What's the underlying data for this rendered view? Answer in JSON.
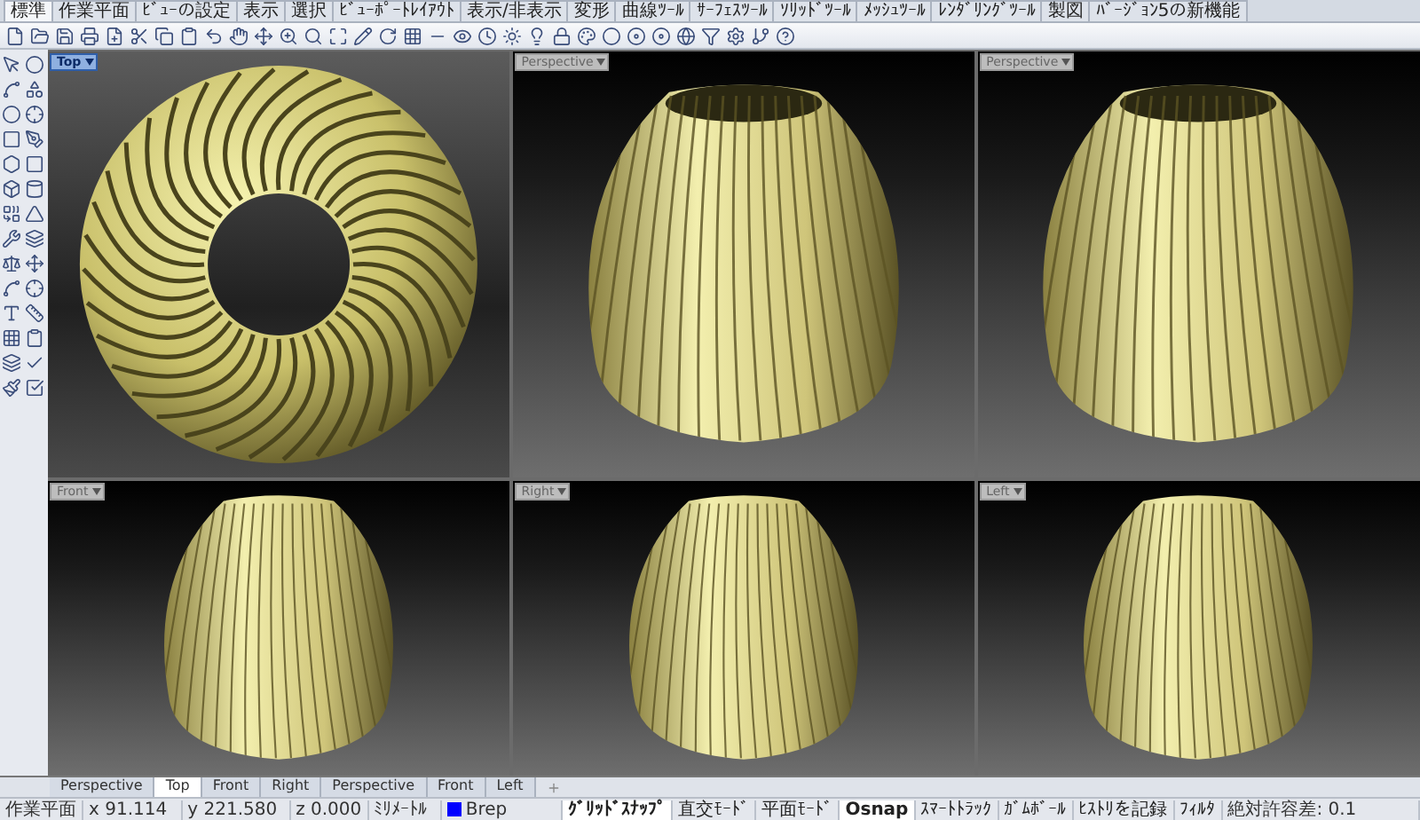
{
  "ribbon_tabs": [
    {
      "label": "標準",
      "selected": true
    },
    {
      "label": "作業平面",
      "selected": false
    },
    {
      "label": "ﾋﾞｭｰの設定",
      "selected": false
    },
    {
      "label": "表示",
      "selected": false
    },
    {
      "label": "選択",
      "selected": false
    },
    {
      "label": "ﾋﾞｭｰﾎﾟｰﾄﾚｲｱｳﾄ",
      "selected": false
    },
    {
      "label": "表示/非表示",
      "selected": false
    },
    {
      "label": "変形",
      "selected": false
    },
    {
      "label": "曲線ﾂｰﾙ",
      "selected": false
    },
    {
      "label": "ｻｰﾌｪｽﾂｰﾙ",
      "selected": false
    },
    {
      "label": "ｿﾘｯﾄﾞﾂｰﾙ",
      "selected": false
    },
    {
      "label": "ﾒｯｼｭﾂｰﾙ",
      "selected": false
    },
    {
      "label": "ﾚﾝﾀﾞﾘﾝｸﾞﾂｰﾙ",
      "selected": false
    },
    {
      "label": "製図",
      "selected": false
    },
    {
      "label": "ﾊﾞｰｼﾞｮﾝ5の新機能",
      "selected": false
    }
  ],
  "viewports": [
    {
      "label": "Top",
      "active": true,
      "kind": "torus"
    },
    {
      "label": "Perspective",
      "active": false,
      "kind": "vase-open"
    },
    {
      "label": "Perspective",
      "active": false,
      "kind": "vase-open"
    },
    {
      "label": "Front",
      "active": false,
      "kind": "vase"
    },
    {
      "label": "Right",
      "active": false,
      "kind": "vase"
    },
    {
      "label": "Left",
      "active": false,
      "kind": "vase"
    }
  ],
  "view_tabs": [
    {
      "label": "Perspective",
      "selected": false
    },
    {
      "label": "Top",
      "selected": true
    },
    {
      "label": "Front",
      "selected": false
    },
    {
      "label": "Right",
      "selected": false
    },
    {
      "label": "Perspective",
      "selected": false
    },
    {
      "label": "Front",
      "selected": false
    },
    {
      "label": "Left",
      "selected": false
    }
  ],
  "status_bar": {
    "cplane": "作業平面",
    "x": "x 91.114",
    "y": "y 221.580",
    "z": "z 0.000",
    "units": "ﾐﾘﾒｰﾄﾙ",
    "layer": {
      "name": "Brep",
      "color": "#0000ff"
    },
    "toggles": [
      {
        "label": "ｸﾞﾘｯﾄﾞｽﾅｯﾌﾟ",
        "on": true
      },
      {
        "label": "直交ﾓｰﾄﾞ",
        "on": false
      },
      {
        "label": "平面ﾓｰﾄﾞ",
        "on": false
      },
      {
        "label": "Osnap",
        "on": true
      },
      {
        "label": "ｽﾏｰﾄﾄﾗｯｸ",
        "on": false
      },
      {
        "label": "ｶﾞﾑﾎﾞｰﾙ",
        "on": false
      },
      {
        "label": "ﾋｽﾄﾘを記録",
        "on": false
      },
      {
        "label": "ﾌｨﾙﾀ",
        "on": false
      }
    ],
    "tolerance": "絶対許容差: 0.1"
  }
}
